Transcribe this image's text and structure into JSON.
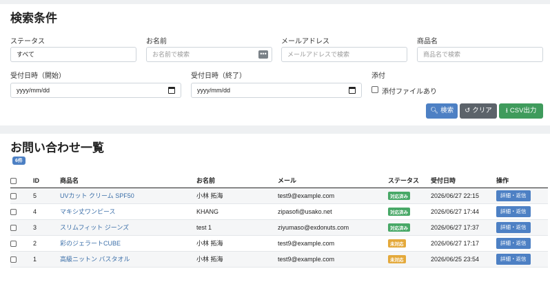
{
  "search": {
    "title": "検索条件",
    "status": {
      "label": "ステータス",
      "value": "すべて"
    },
    "name": {
      "label": "お名前",
      "placeholder": "お名前で検索",
      "picker_glyph": "•••"
    },
    "email": {
      "label": "メールアドレス",
      "placeholder": "メールアドレスで検索"
    },
    "product": {
      "label": "商品名",
      "placeholder": "商品名で検索"
    },
    "date_from": {
      "label": "受付日時（開始）",
      "value": "yyyy/mm/dd"
    },
    "date_to": {
      "label": "受付日時（終了）",
      "value": "yyyy/mm/dd"
    },
    "attachment": {
      "label": "添付",
      "checkbox_label": "添付ファイルあり"
    },
    "buttons": {
      "search": "検索",
      "clear": "クリア",
      "csv": "CSV出力"
    }
  },
  "list": {
    "title": "お問い合わせ一覧",
    "count_badge": "6件",
    "columns": [
      "ID",
      "商品名",
      "お名前",
      "メール",
      "ステータス",
      "受付日時",
      "操作"
    ],
    "rows": [
      {
        "id": "5",
        "product": "UVカット クリーム SPF50",
        "name": "小林 拓海",
        "email": "test9@example.com",
        "status": "対応済み",
        "date": "2026/06/27 22:15",
        "action": "詳細・返信"
      },
      {
        "id": "4",
        "product": "マキシ丈ワンピース",
        "name": "KHANG",
        "email": "zipasofi@usako.net",
        "status": "対応済み",
        "date": "2026/06/27 17:44",
        "action": "詳細・返信"
      },
      {
        "id": "3",
        "product": "スリムフィット ジーンズ",
        "name": "test 1",
        "email": "ziyumaso@exdonuts.com",
        "status": "対応済み",
        "date": "2026/06/27 17:37",
        "action": "詳細・返信"
      },
      {
        "id": "2",
        "product": "彩のジェラートCUBE",
        "name": "小林 拓海",
        "email": "test9@example.com",
        "status": "未対応",
        "date": "2026/06/27 17:17",
        "action": "詳細・返信"
      },
      {
        "id": "1",
        "product": "高級ニットン バスタオル",
        "name": "小林 拓海",
        "email": "test9@example.com",
        "status": "未対応",
        "date": "2026/06/25 23:54",
        "action": "詳細・返信"
      }
    ]
  },
  "colors": {
    "primary": "#4d80c4",
    "secondary": "#5c636a",
    "success": "#3f9b5c",
    "done": "#48a867",
    "todo": "#e4a93b"
  }
}
